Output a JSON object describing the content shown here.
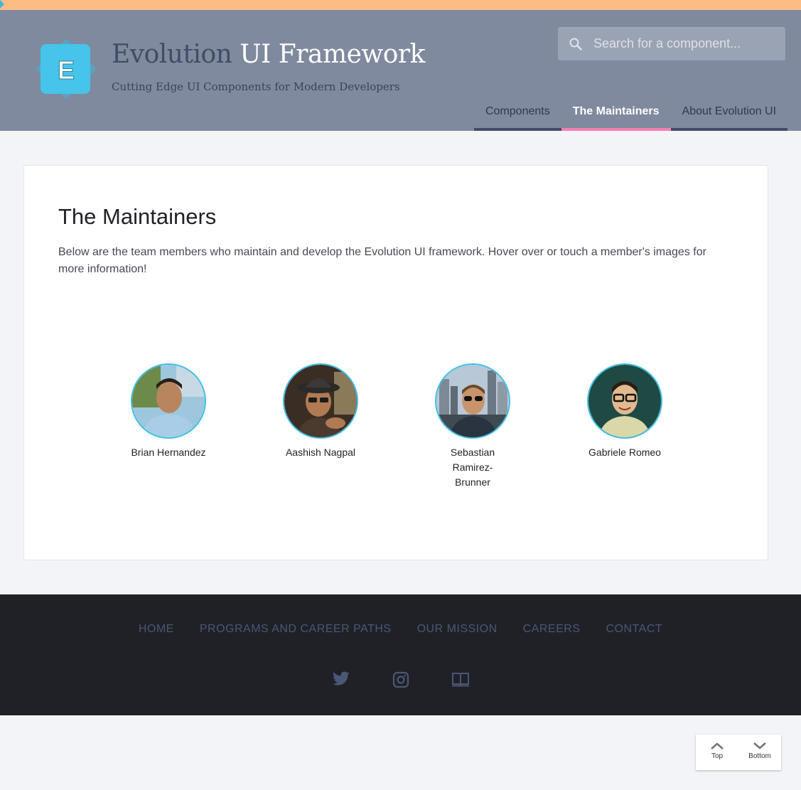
{
  "brand": {
    "title_strong": "Evolution",
    "title_rest": " UI Framework",
    "subtitle": "Cutting Edge UI Components for Modern Developers",
    "logo_letter": "E"
  },
  "search": {
    "placeholder": "Search for a component..."
  },
  "nav": {
    "tabs": [
      {
        "label": "Components",
        "active": false
      },
      {
        "label": "The Maintainers",
        "active": true
      },
      {
        "label": "About Evolution UI",
        "active": false
      }
    ]
  },
  "main": {
    "title": "The Maintainers",
    "intro": "Below are the team members who maintain and develop the Evolution UI framework. Hover over or touch a member's images for more information!",
    "members": [
      {
        "name": "Brian Hernandez"
      },
      {
        "name": "Aashish Nagpal"
      },
      {
        "name": "Sebastian Ramirez-Brunner"
      },
      {
        "name": "Gabriele Romeo"
      }
    ]
  },
  "footer": {
    "links": [
      "HOME",
      "PROGRAMS AND CAREER PATHS",
      "OUR MISSION",
      "CAREERS",
      "CONTACT"
    ],
    "social": [
      "twitter-icon",
      "instagram-icon",
      "book-icon"
    ]
  },
  "scroll": {
    "top_label": "Top",
    "bottom_label": "Bottom"
  },
  "colors": {
    "accent_top": "#fcbc84",
    "header_bg": "#7f8a9e",
    "active_tab": "#f47fb2",
    "avatar_ring": "#3fbfe6",
    "footer_bg": "#1f2127"
  }
}
